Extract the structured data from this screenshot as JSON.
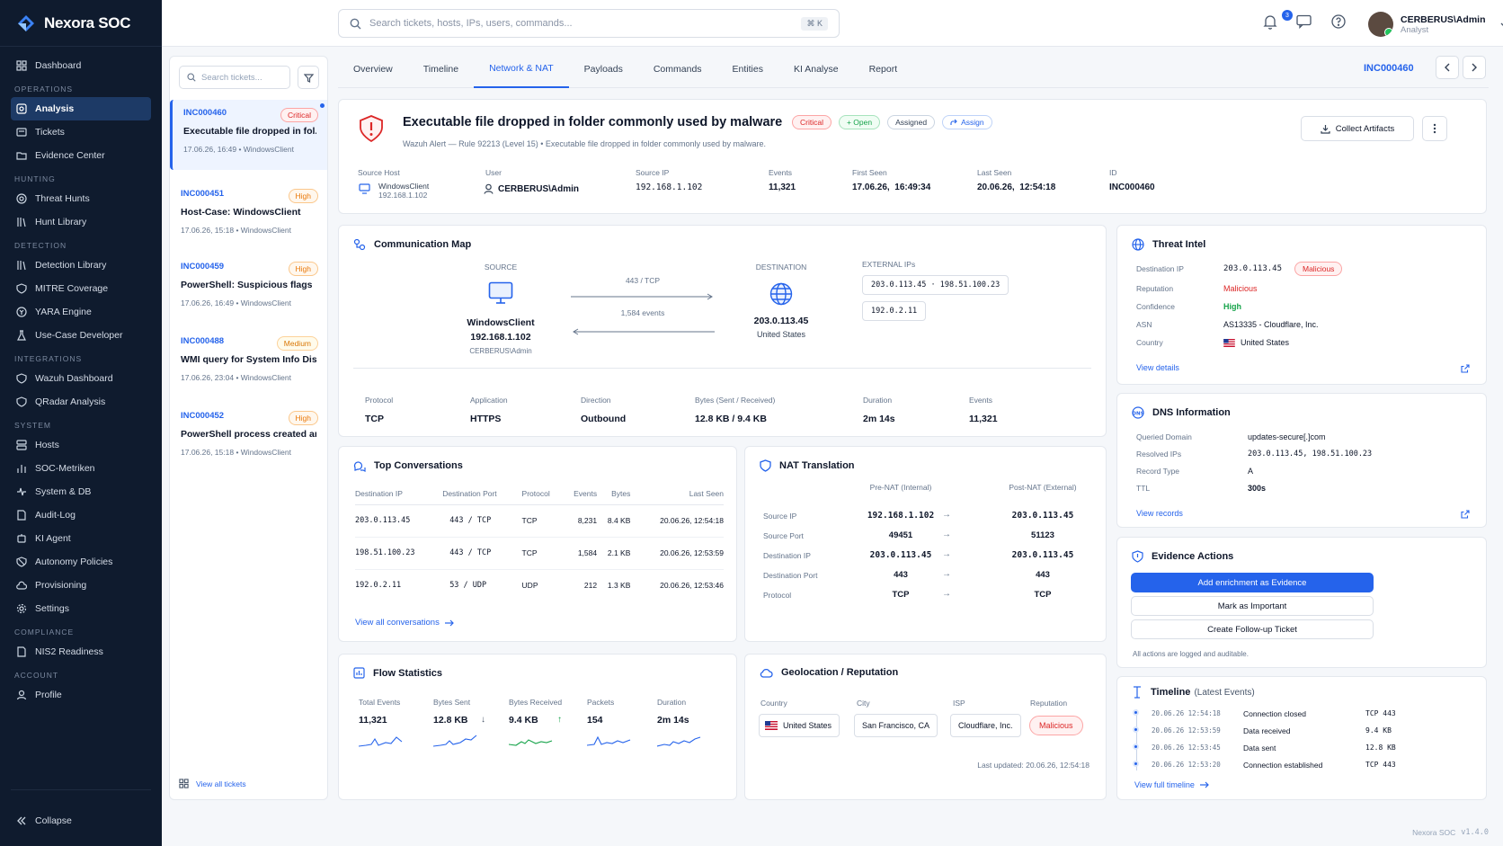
{
  "app": {
    "name": "Nexora SOC",
    "version": "v1.4.0"
  },
  "sidebar": {
    "dashboard": "Dashboard",
    "sections": {
      "operations": "OPERATIONS",
      "hunting": "HUNTING",
      "detection": "DETECTION",
      "integrations": "INTEGRATIONS",
      "system": "SYSTEM",
      "compliance": "COMPLIANCE",
      "account": "ACCOUNT"
    },
    "items": {
      "analysis": "Analysis",
      "tickets": "Tickets",
      "evidence": "Evidence Center",
      "threat_hunts": "Threat Hunts",
      "hunt_library": "Hunt Library",
      "detection_library": "Detection Library",
      "mitre": "MITRE Coverage",
      "yara": "YARA Engine",
      "usecase": "Use-Case Developer",
      "wazuh": "Wazuh Dashboard",
      "qradar": "QRadar Analysis",
      "hosts": "Hosts",
      "soc_metrics": "SOC-Metriken",
      "system_db": "System & DB",
      "audit": "Audit-Log",
      "ki_agent": "KI Agent",
      "autonomy": "Autonomy Policies",
      "provisioning": "Provisioning",
      "settings": "Settings",
      "nis2": "NIS2 Readiness",
      "profile": "Profile"
    },
    "collapse": "Collapse"
  },
  "topbar": {
    "search_placeholder": "Search tickets, hosts, IPs, users, commands...",
    "shortcut": "⌘ K",
    "notifications": "3",
    "user_name": "CERBERUS\\Admin",
    "user_role": "Analyst"
  },
  "ticket_list": {
    "search_placeholder": "Search tickets...",
    "view_all": "View all tickets",
    "tickets": [
      {
        "id": "INC000460",
        "severity": "Critical",
        "title": "Executable file dropped in fol...",
        "meta": "17.06.26, 16:49 • WindowsClient"
      },
      {
        "id": "INC000451",
        "severity": "High",
        "title": "Host-Case: WindowsClient",
        "meta": "17.06.26, 15:18 • WindowsClient"
      },
      {
        "id": "INC000459",
        "severity": "High",
        "title": "PowerShell: Suspicious flags",
        "meta": "17.06.26, 16:49 • WindowsClient"
      },
      {
        "id": "INC000488",
        "severity": "Medium",
        "title": "WMI query for System Info Dis...",
        "meta": "17.06.26, 23:04 • WindowsClient"
      },
      {
        "id": "INC000452",
        "severity": "High",
        "title": "PowerShell process created an...",
        "meta": "17.06.26, 15:18 • WindowsClient"
      }
    ]
  },
  "tabs": [
    "Overview",
    "Timeline",
    "Network & NAT",
    "Payloads",
    "Commands",
    "Entities",
    "KI Analyse",
    "Report"
  ],
  "incident": {
    "id": "INC000460",
    "title": "Executable file dropped in folder commonly used by malware",
    "badges": {
      "critical": "Critical",
      "open": "+ Open",
      "assigned": "Assigned",
      "assign": "Assign"
    },
    "subtitle": "Wazuh Alert — Rule 92213 (Level 15) • Executable file dropped in folder commonly used by malware.",
    "collect": "Collect Artifacts",
    "fields": {
      "source_host_l": "Source Host",
      "source_host_v": "WindowsClient",
      "source_host_ip": "192.168.1.102",
      "user_l": "User",
      "user_v": "CERBERUS\\Admin",
      "source_ip_l": "Source IP",
      "source_ip_v": "192.168.1.102",
      "events_l": "Events",
      "events_v": "11,321",
      "first_seen_l": "First Seen",
      "first_seen_v": "17.06.26,  16:49:34",
      "last_seen_l": "Last Seen",
      "last_seen_v": "20.06.26,  12:54:18",
      "id_l": "ID",
      "id_v": "INC000460"
    }
  },
  "comm_map": {
    "title": "Communication Map",
    "source_l": "SOURCE",
    "source_name": "WindowsClient",
    "source_ip": "192.168.1.102",
    "source_user": "CERBERUS\\Admin",
    "port": "443 / TCP",
    "events": "1,584 events",
    "dest_l": "DESTINATION",
    "dest_ip": "203.0.113.45",
    "dest_country": "United States",
    "ext_l": "EXTERNAL IPs",
    "ext1": "203.0.113.45 · 198.51.100.23",
    "ext2": "192.0.2.11",
    "stats": [
      {
        "l": "Protocol",
        "v": "TCP"
      },
      {
        "l": "Application",
        "v": "HTTPS"
      },
      {
        "l": "Direction",
        "v": "Outbound"
      },
      {
        "l": "Bytes (Sent / Received)",
        "v": "12.8 KB / 9.4 KB"
      },
      {
        "l": "Duration",
        "v": "2m 14s"
      },
      {
        "l": "Events",
        "v": "11,321"
      }
    ]
  },
  "conversations": {
    "title": "Top Conversations",
    "headers": [
      "Destination IP",
      "Destination Port",
      "Protocol",
      "Events",
      "Bytes",
      "Last Seen"
    ],
    "rows": [
      [
        "203.0.113.45",
        "443 / TCP",
        "TCP",
        "8,231",
        "8.4 KB",
        "20.06.26, 12:54:18"
      ],
      [
        "198.51.100.23",
        "443 / TCP",
        "TCP",
        "1,584",
        "2.1 KB",
        "20.06.26, 12:53:59"
      ],
      [
        "192.0.2.11",
        "53 / UDP",
        "UDP",
        "212",
        "1.3 KB",
        "20.06.26, 12:53:46"
      ]
    ],
    "view_all": "View all conversations"
  },
  "nat": {
    "title": "NAT Translation",
    "pre": "Pre-NAT (Internal)",
    "post": "Post-NAT (External)",
    "rows": [
      [
        "Source IP",
        "192.168.1.102",
        "203.0.113.45"
      ],
      [
        "Source Port",
        "49451",
        "51123"
      ],
      [
        "Destination IP",
        "203.0.113.45",
        "203.0.113.45"
      ],
      [
        "Destination Port",
        "443",
        "443"
      ],
      [
        "Protocol",
        "TCP",
        "TCP"
      ]
    ]
  },
  "flow": {
    "title": "Flow Statistics",
    "items": [
      {
        "l": "Total Events",
        "v": "11,321"
      },
      {
        "l": "Bytes Sent",
        "v": "12.8 KB"
      },
      {
        "l": "Bytes Received",
        "v": "9.4 KB"
      },
      {
        "l": "Packets",
        "v": "154"
      },
      {
        "l": "Duration",
        "v": "2m 14s"
      }
    ]
  },
  "geo": {
    "title": "Geolocation / Reputation",
    "country_l": "Country",
    "country_v": "United States",
    "city_l": "City",
    "city_v": "San Francisco, CA",
    "isp_l": "ISP",
    "isp_v": "Cloudflare, Inc.",
    "rep_l": "Reputation",
    "rep_v": "Malicious",
    "updated": "Last updated: 20.06.26, 12:54:18"
  },
  "threat_intel": {
    "title": "Threat Intel",
    "rows": [
      {
        "l": "Destination IP",
        "v": "203.0.113.45"
      },
      {
        "l": "Reputation",
        "v": "Malicious"
      },
      {
        "l": "Confidence",
        "v": "High"
      },
      {
        "l": "ASN",
        "v": "AS13335 - Cloudflare, Inc."
      },
      {
        "l": "Country",
        "v": "United States"
      }
    ],
    "badge": "Malicious",
    "view": "View details"
  },
  "dns": {
    "title": "DNS Information",
    "rows": [
      {
        "l": "Queried Domain",
        "v": "updates-secure[.]com"
      },
      {
        "l": "Resolved IPs",
        "v": "203.0.113.45, 198.51.100.23"
      },
      {
        "l": "Record Type",
        "v": "A"
      },
      {
        "l": "TTL",
        "v": "300s"
      }
    ],
    "view": "View records"
  },
  "evidence": {
    "title": "Evidence Actions",
    "primary": "Add enrichment as Evidence",
    "important": "Mark as Important",
    "followup": "Create Follow-up Ticket",
    "note": "All actions are logged and auditable."
  },
  "timeline": {
    "title": "Timeline",
    "subtitle": "(Latest Events)",
    "rows": [
      [
        "20.06.26 12:54:18",
        "Connection closed",
        "TCP 443"
      ],
      [
        "20.06.26 12:53:59",
        "Data received",
        "9.4 KB"
      ],
      [
        "20.06.26 12:53:45",
        "Data sent",
        "12.8 KB"
      ],
      [
        "20.06.26 12:53:20",
        "Connection established",
        "TCP 443"
      ]
    ],
    "view": "View full timeline"
  },
  "colors": {
    "accent": "#2563eb",
    "sidebar": "#0f1b2e",
    "critical": "#dc2626",
    "high": "#ea7a0c",
    "success": "#16a34a"
  }
}
